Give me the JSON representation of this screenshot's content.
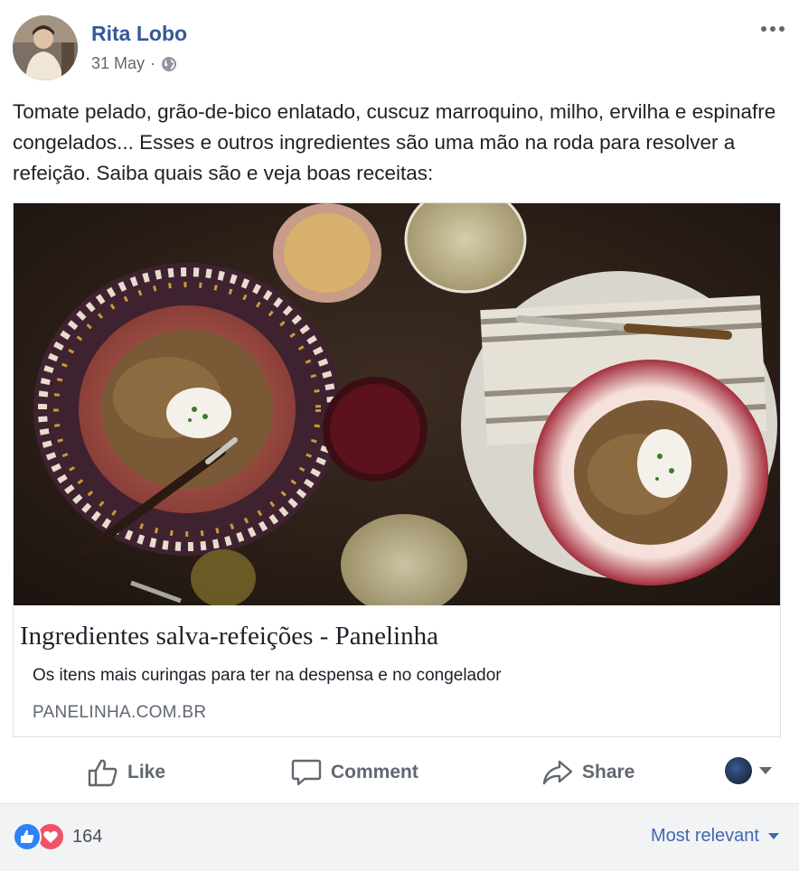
{
  "post": {
    "author": "Rita Lobo",
    "date": "31 May",
    "separator": "·",
    "audience_icon": "globe-icon",
    "text": "Tomate pelado, grão-de-bico enlatado, cuscuz marroquino, milho, ervilha e espinafre congelados... Esses e outros ingredientes são uma mão na roda para resolver a refeição. Saiba quais são e veja boas receitas:"
  },
  "link_card": {
    "title": "Ingredientes salva-refeições - Panelinha",
    "description": "Os itens mais curingas para ter na despensa e no congelador",
    "domain": "PANELINHA.COM.BR"
  },
  "actions": {
    "like": "Like",
    "comment": "Comment",
    "share": "Share"
  },
  "footer": {
    "reaction_count": "164",
    "sort_label": "Most relevant"
  },
  "colors": {
    "link_blue": "#365899",
    "like_blue": "#2f82f5",
    "love_red": "#f25268",
    "muted_text": "#606770",
    "footer_bg": "#f2f3f5"
  }
}
